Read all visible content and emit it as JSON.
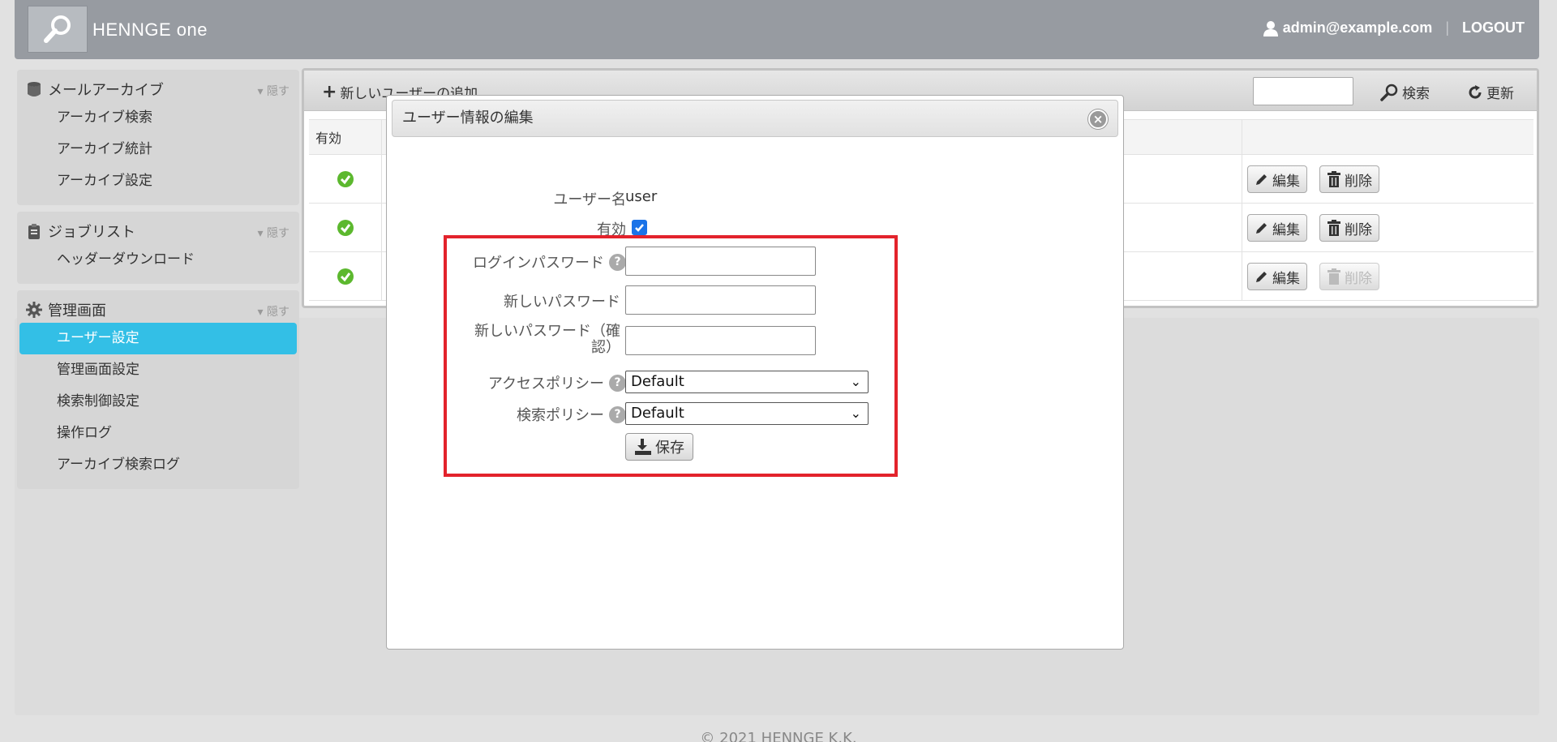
{
  "header": {
    "brand": "HENNGE one",
    "user_email": "admin@example.com",
    "separator": "|",
    "logout": "LOGOUT"
  },
  "sidebar": {
    "hide_label": "▾ 隠す",
    "sections": [
      {
        "title": "メールアーカイブ",
        "items": [
          "アーカイブ検索",
          "アーカイブ統計",
          "アーカイブ設定"
        ]
      },
      {
        "title": "ジョブリスト",
        "items": [
          "ヘッダーダウンロード"
        ]
      },
      {
        "title": "管理画面",
        "items": [
          "ユーザー設定",
          "管理画面設定",
          "検索制御設定",
          "操作ログ",
          "アーカイブ検索ログ"
        ],
        "active_index": 0
      }
    ]
  },
  "toolbar": {
    "add_user": "新しいユーザーの追加",
    "search": "検索",
    "refresh": "更新"
  },
  "table": {
    "header_enabled": "有効",
    "edit": "編集",
    "delete": "削除",
    "rows": [
      {
        "enabled": true,
        "delete_enabled": true
      },
      {
        "enabled": true,
        "delete_enabled": true
      },
      {
        "enabled": true,
        "delete_enabled": false
      }
    ]
  },
  "modal": {
    "title": "ユーザー情報の編集",
    "close_symbol": "×",
    "username_label": "ユーザー名",
    "username_value": "user",
    "enabled_label": "有効",
    "enabled_checked": true,
    "login_password_label": "ログインパスワード",
    "new_password_label": "新しいパスワード",
    "confirm_password_label_1": "新しいパスワード（確",
    "confirm_password_label_2": "認）",
    "access_policy_label": "アクセスポリシー",
    "access_policy_value": "Default",
    "search_policy_label": "検索ポリシー",
    "search_policy_value": "Default",
    "help_symbol": "?",
    "save": "保存"
  },
  "footer": {
    "copyright": "© 2021 HENNGE K.K."
  },
  "colors": {
    "header_bg": "#979ba1",
    "active_item": "#33bfe6",
    "highlight_border": "#e3232c",
    "check_green": "#5cb82e"
  }
}
